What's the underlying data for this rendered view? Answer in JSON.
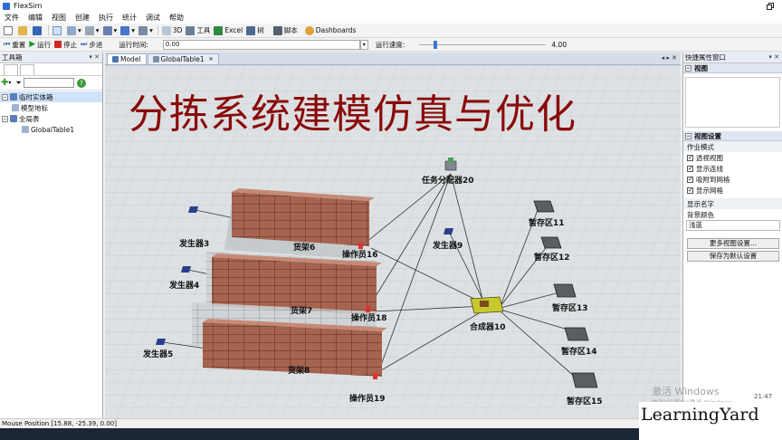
{
  "window": {
    "title": "FlexSim",
    "restore_icon": "restore-icon"
  },
  "menu": [
    "文件",
    "编辑",
    "视图",
    "创建",
    "执行",
    "统计",
    "调试",
    "帮助"
  ],
  "toolbar1": {
    "view3d": "3D",
    "tools": "工具",
    "excel": "Excel",
    "tree": "树",
    "script": "脚本",
    "dashboards": "Dashboards"
  },
  "toolbar2": {
    "reset": "重置",
    "run": "运行",
    "stop": "停止",
    "step": "步进",
    "run_time_label": "运行时间:",
    "run_time_value": "0.00",
    "run_speed_label": "运行速度:",
    "run_speed_value": "4.00",
    "run_speed_fraction": 0.12
  },
  "library": {
    "title": "工具箱",
    "tree": [
      {
        "label": "临时实体箱",
        "expander": "−",
        "selected": true,
        "indent": 0
      },
      {
        "label": "模型地标",
        "expander": "",
        "selected": false,
        "indent": 1
      },
      {
        "label": "全局表",
        "expander": "−",
        "selected": false,
        "indent": 0
      },
      {
        "label": "GlobalTable1",
        "expander": "",
        "selected": false,
        "indent": 2
      }
    ]
  },
  "tabs": {
    "model": "Model",
    "table": "GlobalTable1"
  },
  "model": {
    "title": "分拣系统建模仿真与优化",
    "labels": {
      "dispatcher": "任务分配器20",
      "src3": "发生器3",
      "src4": "发生器4",
      "src5": "发生器5",
      "src9": "发生器9",
      "rack6": "货架6",
      "rack7": "货架7",
      "rack8": "货架8",
      "op16": "操作员16",
      "op18": "操作员18",
      "op19": "操作员19",
      "combiner": "合成器10",
      "q11": "暂存区11",
      "q12": "暂存区12",
      "q13": "暂存区13",
      "q14": "暂存区14",
      "q15": "暂存区15"
    }
  },
  "quickprops": {
    "title": "快捷属性窗口",
    "view_section": "视图",
    "view_settings_section": "视图设置",
    "work_mode": "作业模式",
    "checkboxes": [
      {
        "label": "透视视图",
        "checked": true
      },
      {
        "label": "显示连线",
        "checked": true
      },
      {
        "label": "吸附到网格",
        "checked": true
      },
      {
        "label": "显示网格",
        "checked": true
      }
    ],
    "show_names": "显示名字",
    "bg_color": "背景颜色",
    "bg_value": "浅蓝",
    "more_btn": "更多视图设置...",
    "save_btn": "保存为默认设置"
  },
  "watermark": {
    "line1": "激活 Windows",
    "line2": "转到\"设置\"以激活 Windows。"
  },
  "status": "Mouse Position [15.88, -25.39, 0.00]",
  "clock": "21:47",
  "brand": "LearningYard"
}
